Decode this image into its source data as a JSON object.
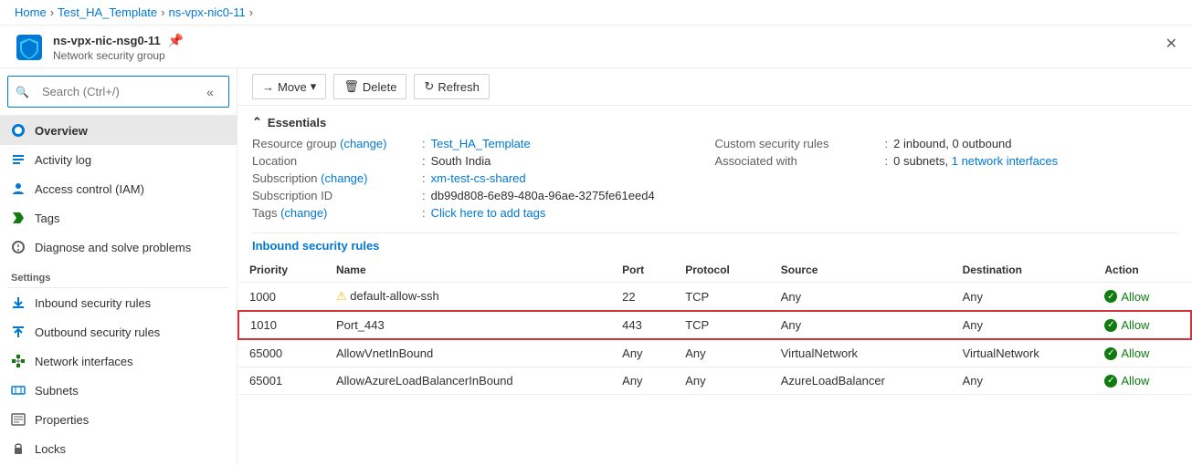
{
  "breadcrumb": {
    "items": [
      "Home",
      "Test_HA_Template",
      "ns-vpx-nic0-11"
    ]
  },
  "header": {
    "title": "ns-vpx-nic-nsg0-11",
    "subtitle": "Network security group",
    "pin_label": "📌",
    "close_label": "✕"
  },
  "sidebar": {
    "search_placeholder": "Search (Ctrl+/)",
    "items": [
      {
        "id": "overview",
        "label": "Overview",
        "icon": "overview",
        "active": true
      },
      {
        "id": "activity-log",
        "label": "Activity log",
        "icon": "activity"
      },
      {
        "id": "access-control",
        "label": "Access control (IAM)",
        "icon": "iam"
      },
      {
        "id": "tags",
        "label": "Tags",
        "icon": "tags"
      },
      {
        "id": "diagnose",
        "label": "Diagnose and solve problems",
        "icon": "diagnose"
      }
    ],
    "settings_header": "Settings",
    "settings_items": [
      {
        "id": "inbound",
        "label": "Inbound security rules",
        "icon": "inbound"
      },
      {
        "id": "outbound",
        "label": "Outbound security rules",
        "icon": "outbound"
      },
      {
        "id": "network-interfaces",
        "label": "Network interfaces",
        "icon": "network"
      },
      {
        "id": "subnets",
        "label": "Subnets",
        "icon": "subnets"
      },
      {
        "id": "properties",
        "label": "Properties",
        "icon": "properties"
      },
      {
        "id": "locks",
        "label": "Locks",
        "icon": "locks"
      }
    ]
  },
  "toolbar": {
    "move_label": "Move",
    "delete_label": "Delete",
    "refresh_label": "Refresh"
  },
  "essentials": {
    "header": "Essentials",
    "left": [
      {
        "label": "Resource group (change)",
        "value": "Test_HA_Template",
        "link": true
      },
      {
        "label": "Location",
        "value": "South India",
        "link": false
      },
      {
        "label": "Subscription (change)",
        "value": "xm-test-cs-shared",
        "link": true
      },
      {
        "label": "Subscription ID",
        "value": "db99d808-6e89-480a-96ae-3275fe61eed4",
        "link": false
      },
      {
        "label": "Tags (change)",
        "value": "Click here to add tags",
        "link": true
      }
    ],
    "right": [
      {
        "label": "Custom security rules",
        "value": "2 inbound, 0 outbound",
        "link": false
      },
      {
        "label": "Associated with",
        "value": "0 subnets, 1 network interfaces",
        "link_part": "1 network interfaces",
        "link": true
      }
    ]
  },
  "inbound_rules": {
    "section_label": "Inbound security rules",
    "columns": [
      "Priority",
      "Name",
      "Port",
      "Protocol",
      "Source",
      "Destination",
      "Action"
    ],
    "rows": [
      {
        "priority": "1000",
        "name": "default-allow-ssh",
        "port": "22",
        "protocol": "TCP",
        "source": "Any",
        "destination": "Any",
        "action": "Allow",
        "warn": true,
        "highlighted": false
      },
      {
        "priority": "1010",
        "name": "Port_443",
        "port": "443",
        "protocol": "TCP",
        "source": "Any",
        "destination": "Any",
        "action": "Allow",
        "warn": false,
        "highlighted": true
      },
      {
        "priority": "65000",
        "name": "AllowVnetInBound",
        "port": "Any",
        "protocol": "Any",
        "source": "VirtualNetwork",
        "destination": "VirtualNetwork",
        "action": "Allow",
        "warn": false,
        "highlighted": false
      },
      {
        "priority": "65001",
        "name": "AllowAzureLoadBalancerInBound",
        "port": "Any",
        "protocol": "Any",
        "source": "AzureLoadBalancer",
        "destination": "Any",
        "action": "Allow",
        "warn": false,
        "highlighted": false
      }
    ]
  },
  "colors": {
    "accent": "#0078d4",
    "danger": "#d13438",
    "success": "#107c10",
    "warning": "#ffb900"
  }
}
